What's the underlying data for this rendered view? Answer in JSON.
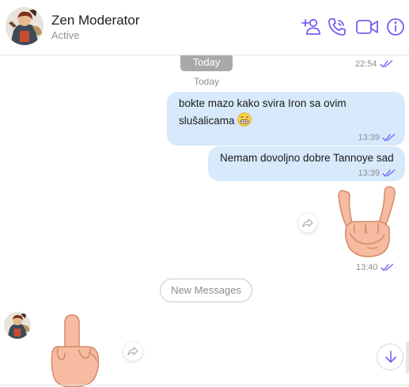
{
  "header": {
    "title": "Zen Moderator",
    "status": "Active",
    "icons": [
      "add-contact-icon",
      "phone-icon",
      "video-icon",
      "info-icon"
    ],
    "accent_color": "#7360f2"
  },
  "chat": {
    "date_pill": "Today",
    "date_label": "Today",
    "top_time": "22:54",
    "messages": [
      {
        "text": "bokte mazo kako svira Iron sa ovim slušalicama",
        "emoji": "grinning-face-emoji",
        "time": "13:39"
      },
      {
        "text": "Nemam dovoljno dobre Tannoye sad",
        "time": "13:39"
      },
      {
        "sticker": "rock-on-hand-sticker",
        "time": "13:40"
      }
    ],
    "new_messages_label": "New Messages",
    "incoming_sticker": "middle-finger-sticker",
    "bubble_color": "#d7e9fb",
    "tick_color": "#7360f2"
  }
}
